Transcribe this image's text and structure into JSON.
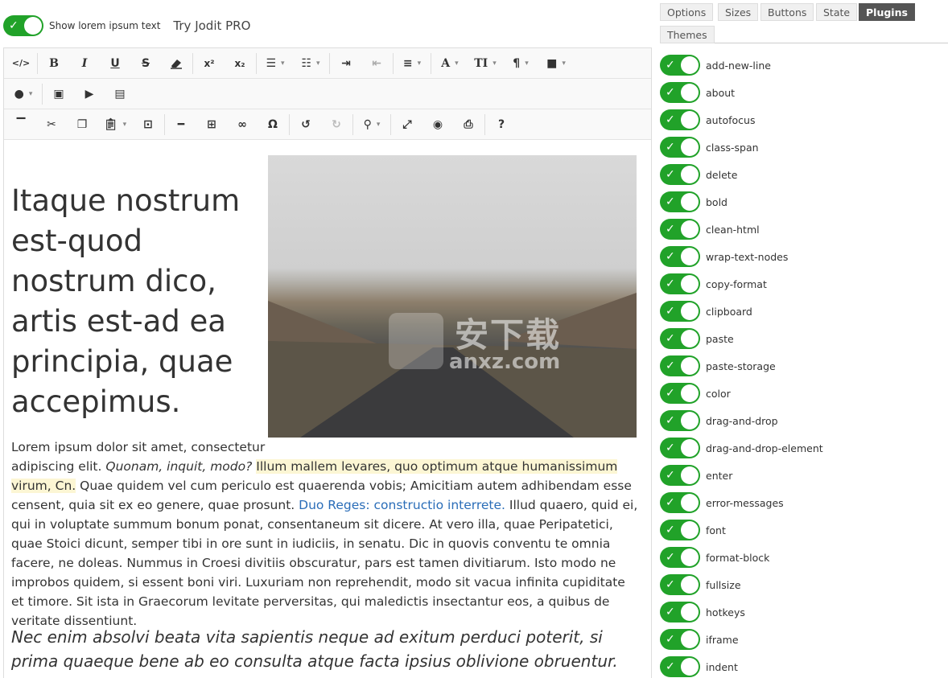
{
  "top": {
    "show_lorem_label": "Show lorem ipsum text",
    "try_pro": "Try Jodit PRO"
  },
  "toolbar": {
    "row1": [
      "</>",
      "B",
      "I",
      "U",
      "S",
      "eraser",
      "x²",
      "x₂",
      "ul",
      "ol",
      "indent",
      "outdent",
      "align",
      "A",
      "TI",
      "¶",
      "brush"
    ],
    "row2": [
      "drop",
      "image",
      "video",
      "file"
    ],
    "row3": [
      "copyformat",
      "cut",
      "copy",
      "paste",
      "selectall",
      "hr",
      "table",
      "link",
      "Ω",
      "undo",
      "redo",
      "find",
      "fullsize",
      "preview",
      "print",
      "?"
    ]
  },
  "content": {
    "heading": "Itaque nostrum est-quod nostrum dico, artis est-ad ea principia, quae accepimus.",
    "para_start": "Lorem ipsum dolor sit amet, consectetur",
    "para_a": "adipiscing elit.",
    "para_em": "Quonam, inquit, modo?",
    "para_hl": "Illum mallem levares, quo optimum atque humanissimum virum, Cn.",
    "para_b": "Quae quidem vel cum periculo est quaerenda vobis; Amicitiam autem adhibendam esse censent, quia sit ex eo genere, quae prosunt.",
    "para_link": "Duo Reges: constructio interrete.",
    "para_c": "Illud quaero, quid ei, qui in voluptate summum bonum ponat, consentaneum sit dicere. At vero illa, quae Peripatetici, quae Stoici dicunt, semper tibi in ore sunt in iudiciis, in senatu. Dic in quovis conventu te omnia facere, ne doleas. Nummus in Croesi divitiis obscuratur, pars est tamen divitiarum. Isto modo ne improbos quidem, si essent boni viri. Luxuriam non reprehendit, modo sit vacua infinita cupiditate et timore. Sit ista in Graecorum levitate perversitas, qui maledictis insectantur eos, a quibus de veritate dissentiunt.",
    "quote": "Nec enim absolvi beata vita sapientis neque ad exitum perduci poterit, si prima quaeque bene ab eo consulta atque facta ipsius oblivione obruentur.",
    "watermark": "安下载",
    "watermark_sub": "anxz.com"
  },
  "tabs": [
    {
      "label": "Options"
    },
    {
      "label": "Sizes"
    },
    {
      "label": "Buttons"
    },
    {
      "label": "State"
    },
    {
      "label": "Plugins"
    },
    {
      "label": "Themes"
    }
  ],
  "plugins": [
    "add-new-line",
    "about",
    "autofocus",
    "class-span",
    "delete",
    "bold",
    "clean-html",
    "wrap-text-nodes",
    "copy-format",
    "clipboard",
    "paste",
    "paste-storage",
    "color",
    "drag-and-drop",
    "drag-and-drop-element",
    "enter",
    "error-messages",
    "font",
    "format-block",
    "fullsize",
    "hotkeys",
    "iframe",
    "indent"
  ],
  "colors": {
    "toggle_on": "#21a229",
    "link": "#2a6db8",
    "highlight": "#fcf6d4"
  }
}
